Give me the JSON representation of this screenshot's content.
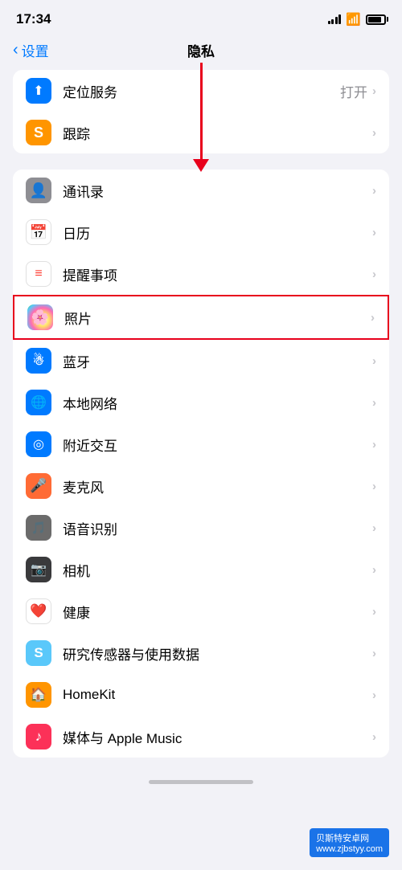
{
  "statusBar": {
    "time": "17:34",
    "locationIcon": "▶",
    "batteryLabel": "battery"
  },
  "nav": {
    "backLabel": "设置",
    "title": "隐私"
  },
  "groups": [
    {
      "id": "location-tracking",
      "rows": [
        {
          "id": "location-services",
          "label": "定位服务",
          "value": "打开",
          "showChevron": true,
          "iconBg": "blue",
          "iconSymbol": "✦"
        },
        {
          "id": "tracking",
          "label": "跟踪",
          "value": "",
          "showChevron": true,
          "iconBg": "orange",
          "iconSymbol": "S"
        }
      ]
    },
    {
      "id": "data-access",
      "rows": [
        {
          "id": "contacts",
          "label": "通讯录",
          "value": "",
          "showChevron": true,
          "iconBg": "gray",
          "iconSymbol": "👤"
        },
        {
          "id": "calendar",
          "label": "日历",
          "value": "",
          "showChevron": true,
          "iconBg": "red",
          "iconSymbol": "📅"
        },
        {
          "id": "reminders",
          "label": "提醒事项",
          "value": "",
          "showChevron": true,
          "iconBg": "white",
          "iconSymbol": "☰"
        },
        {
          "id": "photos",
          "label": "照片",
          "value": "",
          "showChevron": true,
          "iconBg": "photos",
          "iconSymbol": "🌸",
          "highlighted": true
        },
        {
          "id": "bluetooth",
          "label": "蓝牙",
          "value": "",
          "showChevron": true,
          "iconBg": "blue",
          "iconSymbol": "B"
        },
        {
          "id": "local-network",
          "label": "本地网络",
          "value": "",
          "showChevron": true,
          "iconBg": "blue",
          "iconSymbol": "🌐"
        },
        {
          "id": "nearby-interaction",
          "label": "附近交互",
          "value": "",
          "showChevron": true,
          "iconBg": "blue",
          "iconSymbol": "◎"
        },
        {
          "id": "microphone",
          "label": "麦克风",
          "value": "",
          "showChevron": true,
          "iconBg": "orange",
          "iconSymbol": "🎤"
        },
        {
          "id": "speech-recognition",
          "label": "语音识别",
          "value": "",
          "showChevron": true,
          "iconBg": "gray",
          "iconSymbol": "🎵"
        },
        {
          "id": "camera",
          "label": "相机",
          "value": "",
          "showChevron": true,
          "iconBg": "dark",
          "iconSymbol": "📷"
        },
        {
          "id": "health",
          "label": "健康",
          "value": "",
          "showChevron": true,
          "iconBg": "health",
          "iconSymbol": "❤️"
        },
        {
          "id": "research",
          "label": "研究传感器与使用数据",
          "value": "",
          "showChevron": true,
          "iconBg": "teal",
          "iconSymbol": "S"
        },
        {
          "id": "homekit",
          "label": "HomeKit",
          "value": "",
          "showChevron": true,
          "iconBg": "orange",
          "iconSymbol": "🏠"
        },
        {
          "id": "media-music",
          "label": "媒体与 Apple Music",
          "value": "",
          "showChevron": true,
          "iconBg": "music",
          "iconSymbol": "♪"
        }
      ]
    }
  ],
  "watermark": {
    "text": "贝斯特安卓网",
    "url": "www.zjbstyy.com"
  },
  "homeIndicator": true
}
